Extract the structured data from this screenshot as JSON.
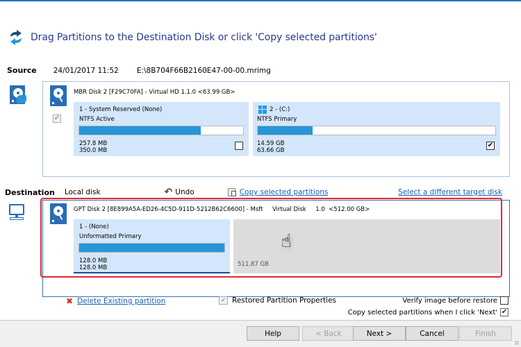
{
  "header": {
    "title": "Drag Partitions to the Destination Disk or click 'Copy selected partitions'",
    "icon": "refresh-arrows-icon"
  },
  "source": {
    "label": "Source",
    "date": "24/01/2017 11:52",
    "path": "E:\\8B704F66B2160E47-00-00.mrimg",
    "disk_title": "MBR Disk 2 [F29C70FA] - Virtual HD 1.1.0  <63.99 GB>",
    "disk_checkbox_checked": true,
    "partitions": [
      {
        "name": "1 - System Reserved (None)",
        "type": "NTFS Active",
        "used": "257.8 MB",
        "total": "350.0 MB",
        "used_fraction": 0.74,
        "checked": false,
        "icon": null
      },
      {
        "name": "2 -  (C:)",
        "type": "NTFS Primary",
        "used": "14.59 GB",
        "total": "63.66 GB",
        "used_fraction": 0.23,
        "checked": true,
        "icon": "windows-logo-icon"
      }
    ]
  },
  "destination": {
    "label": "Destination",
    "target": "Local disk",
    "undo_label": "Undo",
    "copy_label": "Copy selected partitions",
    "select_target_label": "Select a different target disk",
    "disk_title": "GPT Disk 2 [8E899A5A-ED26-4C5D-911D-5212B62C6600] - Msft     Virtual Disk     1.0  <512.00 GB>",
    "partitions": [
      {
        "name": "1 -  (None)",
        "type": "Unformatted Primary",
        "used": "128.0 MB",
        "total": "128.0 MB",
        "used_fraction": 1.0
      }
    ],
    "unallocated": "511.87 GB"
  },
  "options": {
    "delete_label": "Delete Existing partition",
    "restored_props_label": "Restored Partition Properties",
    "verify_label": "Verify image before restore",
    "verify_checked": false,
    "copy_on_next_label": "Copy selected partitions when I click 'Next'",
    "copy_on_next_checked": true
  },
  "buttons": {
    "help": "Help",
    "back": "< Back",
    "next": "Next >",
    "cancel": "Cancel",
    "finish": "Finish"
  },
  "glyphs": {
    "check": "✔",
    "empty": "",
    "x": "✖",
    "undo": "↶",
    "hand": "☝"
  }
}
